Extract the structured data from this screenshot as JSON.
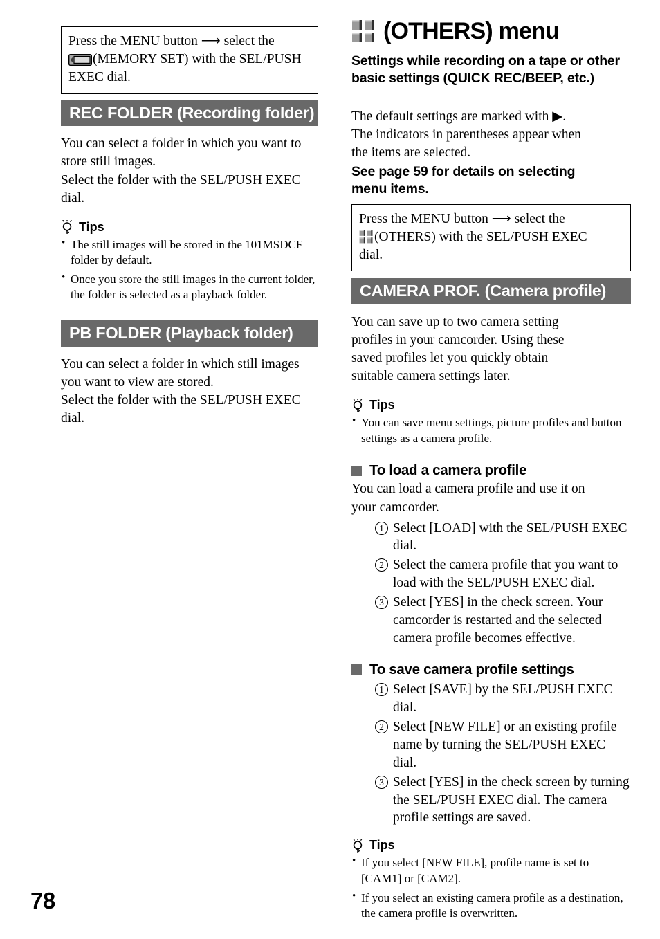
{
  "page": {
    "number": "78",
    "accent_gray": "#696969",
    "marker_gray": "#6a6a6a"
  },
  "left_column": {
    "menu_box": {
      "line1_pre": "Press the MENU button",
      "arrow": "⟶",
      "line1_post": "select the",
      "icon_name": "memory-set-icon",
      "line2": "(MEMORY SET) with the SEL/PUSH",
      "line3": "EXEC dial."
    },
    "sections": [
      {
        "title": "REC FOLDER (Recording folder)",
        "body": "You can select a folder in which you want to store still images.\nSelect the folder with the SEL/PUSH EXEC dial.",
        "tips_label": "Tips",
        "tips": [
          "The still images will be stored in the 101MSDCF folder by default.",
          "Once you store the still images in the current folder, the folder is selected as a playback folder."
        ]
      },
      {
        "title": "PB FOLDER (Playback folder)",
        "body": "You can select a folder in which still images you want to view are stored.\nSelect the folder with the SEL/PUSH EXEC dial."
      }
    ]
  },
  "right_column": {
    "title": "(OTHERS) menu",
    "title_icon": "others-grid-icon",
    "subtitle": "Settings while recording on a tape or other basic settings (QUICK REC/BEEP, etc.)",
    "intro": "The default settings are marked with ▶.\nThe indicators in parentheses appear when the items are selected.",
    "see_page_note": "See page 59 for details on selecting menu items.",
    "menu_box": {
      "line1_pre": "Press the MENU button",
      "arrow": "⟶",
      "line1_post": "select the",
      "icon_name": "others-grid-icon",
      "line2": "(OTHERS) with the SEL/PUSH EXEC",
      "line3": "dial."
    },
    "section": {
      "title": "CAMERA PROF. (Camera profile)",
      "body": "You can save up to two camera setting profiles in your camcorder. Using these saved profiles let you quickly obtain suitable camera settings later.",
      "tips_label": "Tips",
      "tips": [
        "You can save menu settings, picture profiles and button settings as a camera profile."
      ],
      "subsections": [
        {
          "heading": "To load a camera profile",
          "intro": "You can load a camera profile and use it on your camcorder.",
          "steps": [
            {
              "num": "1",
              "text": "Select [LOAD] with the SEL/PUSH EXEC dial."
            },
            {
              "num": "2",
              "text": "Select the camera profile that you want to load with the SEL/PUSH EXEC dial."
            },
            {
              "num": "3",
              "text": "Select [YES] in the check screen. Your camcorder is restarted and the selected camera profile becomes effective."
            }
          ]
        },
        {
          "heading": "To save camera profile settings",
          "intro": "",
          "steps": [
            {
              "num": "1",
              "text": "Select [SAVE] by the SEL/PUSH EXEC dial."
            },
            {
              "num": "2",
              "text": "Select [NEW FILE] or an existing profile name by turning the SEL/PUSH EXEC dial."
            },
            {
              "num": "3",
              "text": "Select [YES] in the check screen by turning the SEL/PUSH EXEC dial. The camera profile settings are saved."
            }
          ]
        }
      ],
      "tips2_label": "Tips",
      "tips2": [
        "If you select [NEW FILE], profile name is set to [CAM1] or [CAM2].",
        "If you select an existing camera profile as a destination, the camera profile is overwritten."
      ]
    }
  }
}
